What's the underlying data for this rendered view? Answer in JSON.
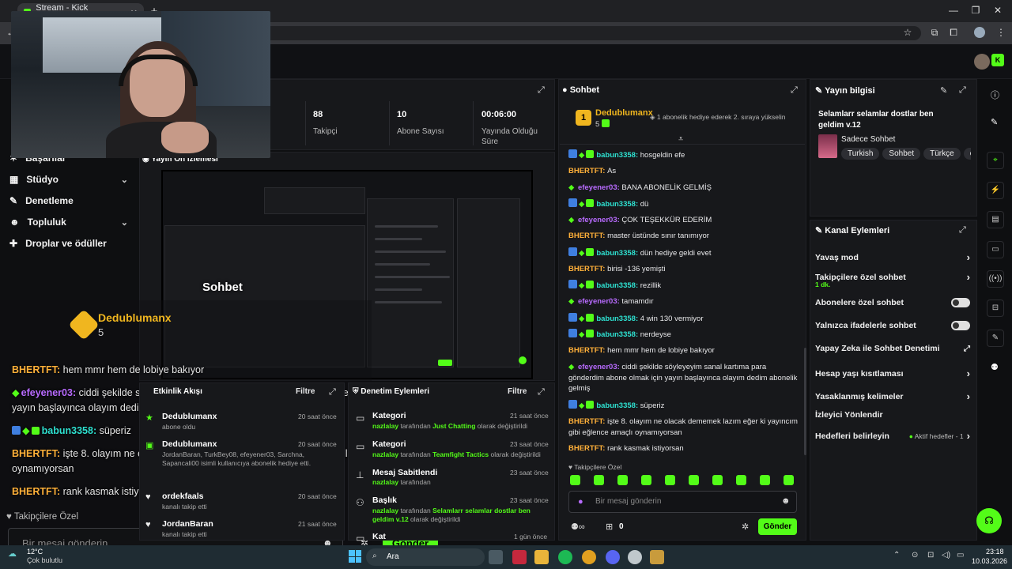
{
  "browser": {
    "tab_title": "Stream - Kick Dashboard",
    "tab_close": "✕",
    "new_tab": "+"
  },
  "stats": [
    {
      "value": "88",
      "label": "Takipçi"
    },
    {
      "value": "10",
      "label": "Abone Sayısı"
    },
    {
      "value": "00:06:00",
      "label": "Yayında Olduğu Süre"
    }
  ],
  "sidebar": {
    "items": [
      {
        "label": "Başarılar",
        "chev": ""
      },
      {
        "label": "Stüdyo",
        "chev": "⌄"
      },
      {
        "label": "Denetleme",
        "chev": ""
      },
      {
        "label": "Topluluk",
        "chev": "⌄"
      },
      {
        "label": "Droplar ve ödüller",
        "chev": ""
      }
    ]
  },
  "preview": {
    "title": "Yayın Ön İzlemesi"
  },
  "chat": {
    "title": "Sohbet",
    "pinned_user": "Dedublumanx",
    "pinned_count": "5",
    "pinned_badge": "1",
    "pinned_msg": "1 abonelik hediye ederek 2. sıraya yükselin",
    "messages": [
      {
        "user": "babun3358",
        "text": "hosgeldin efe",
        "type": "cyan",
        "badges": "vip"
      },
      {
        "user": "BHERTFT",
        "text": "As",
        "type": "orange",
        "badges": ""
      },
      {
        "user": "efeyener03",
        "text": "BANA ABONELİK GELMİŞ",
        "type": "pink",
        "badges": "star"
      },
      {
        "user": "babun3358",
        "text": "dü",
        "type": "cyan",
        "badges": "vip"
      },
      {
        "user": "efeyener03",
        "text": "ÇOK TEŞEKKÜR EDERİM",
        "type": "pink",
        "badges": "star"
      },
      {
        "user": "BHERTFT",
        "text": "master üstünde sınır tanımıyor",
        "type": "orange",
        "badges": ""
      },
      {
        "user": "babun3358",
        "text": "dün hediye geldi evet",
        "type": "cyan",
        "badges": "vip"
      },
      {
        "user": "BHERTFT",
        "text": "birisi -136 yemişti",
        "type": "orange",
        "badges": ""
      },
      {
        "user": "babun3358",
        "text": "rezillik",
        "type": "cyan",
        "badges": "vip"
      },
      {
        "user": "efeyener03",
        "text": "tamamdır",
        "type": "pink",
        "badges": "star"
      },
      {
        "user": "babun3358",
        "text": "4 win 130 vermiyor",
        "type": "cyan",
        "badges": "vip"
      },
      {
        "user": "babun3358",
        "text": "nerdeyse",
        "type": "cyan",
        "badges": "vip"
      },
      {
        "user": "BHERTFT",
        "text": "hem mmr hem de lobiye bakıyor",
        "type": "orange",
        "badges": ""
      },
      {
        "user": "efeyener03",
        "text": "ciddi şekilde söyleyeyim sanal kartıma para gönderdim abone olmak için yayın başlayınca olayım dedim abonelik gelmiş",
        "type": "pink",
        "badges": "star"
      },
      {
        "user": "babun3358",
        "text": "süperiz",
        "type": "cyan",
        "badges": "vip"
      },
      {
        "user": "BHERTFT",
        "text": "işte 8. olayım ne olacak dememek lazım eğer ki yayıncım gibi eğlence amaçlı oynamıyorsan",
        "type": "orange",
        "badges": ""
      },
      {
        "user": "BHERTFT",
        "text": "rank kasmak istiyorsan",
        "type": "orange",
        "badges": ""
      }
    ],
    "followers_only": "Takipçilere Özel",
    "placeholder": "Bir mesaj gönderin",
    "points": "0",
    "send": "Gönder"
  },
  "stream_info": {
    "title": "Yayın bilgisi",
    "stream_title": "Selamlarr selamlar dostlar ben geldim v.12",
    "category": "Sadece Sohbet",
    "tags": [
      "Turkish",
      "Sohbet",
      "Türkçe",
      "chi"
    ]
  },
  "channel_actions": {
    "title": "Kanal Eylemleri",
    "rows": [
      {
        "label": "Yavaş mod",
        "control": "chev",
        "sub": ""
      },
      {
        "label": "Takipçilere özel sohbet",
        "control": "chev",
        "sub": "1 dk."
      },
      {
        "label": "Abonelere özel sohbet",
        "control": "toggle",
        "sub": ""
      },
      {
        "label": "Yalnızca ifadelerle sohbet",
        "control": "toggle",
        "sub": ""
      },
      {
        "label": "Yapay Zeka ile Sohbet Denetimi",
        "control": "ext",
        "sub": ""
      },
      {
        "label": "Hesap yaşı kısıtlaması",
        "control": "chev",
        "sub": ""
      },
      {
        "label": "Yasaklanmış kelimeler",
        "control": "chev",
        "sub": ""
      },
      {
        "label": "İzleyici Yönlendir",
        "control": "",
        "sub": ""
      },
      {
        "label": "Hedefleri belirleyin",
        "control": "chev",
        "sub": "Aktif hedefler - 1"
      }
    ]
  },
  "activity": {
    "title": "Etkinlik Akışı",
    "filter": "Filtre",
    "items": [
      {
        "name": "Dedublumanx",
        "time": "20 saat önce",
        "desc": "abone oldu"
      },
      {
        "name": "Dedublumanx",
        "time": "20 saat önce",
        "desc": "JordanBaran, TurkBey08, efeyener03, Sarchna, Sapancali00 isimli kullanıcıya abonelik hediye etti."
      },
      {
        "name": "ordekfaals",
        "time": "20 saat önce",
        "desc": "kanalı takip etti"
      },
      {
        "name": "JordanBaran",
        "time": "21 saat önce",
        "desc": "kanalı takip etti"
      }
    ]
  },
  "mod_actions": {
    "title": "Denetim Eylemleri",
    "filter": "Filtre",
    "items": [
      {
        "title": "Kategori",
        "time": "21 saat önce",
        "actor": "nazlalay",
        "mid": " tarafından ",
        "target": "Just Chatting",
        "end": " olarak değiştirildi"
      },
      {
        "title": "Kategori",
        "time": "23 saat önce",
        "actor": "nazlalay",
        "mid": " tarafından ",
        "target": "Teamfight Tactics",
        "end": " olarak değiştirildi"
      },
      {
        "title": "Mesaj Sabitlendi",
        "time": "23 saat önce",
        "actor": "nazlalay",
        "mid": " tarafından",
        "target": "",
        "end": ""
      },
      {
        "title": "Başlık",
        "time": "23 saat önce",
        "actor": "nazlalay",
        "mid": " tarafından ",
        "target": "Selamlarr selamlar dostlar ben geldim v.12",
        "end": " olarak değiştirildi"
      }
    ],
    "partial": "Kat",
    "partial_time": "1 gün önce"
  },
  "overlay": {
    "pinned_user": "Dedublumanx",
    "pinned_count": "5",
    "chat_title": "Sohbet",
    "lines": [
      {
        "user": "BHERTFT",
        "text": "hem mmr hem de lobiye bakıyor",
        "type": "orange"
      },
      {
        "user": "efeyener03",
        "text": "ciddi şekilde söyleyeyim sanal kartıma para gönderdim abone olmak için yayın başlayınca olayım dedim abonelik gelmiş",
        "type": "pink"
      },
      {
        "user": "babun3358",
        "text": "süperiz",
        "type": "cyan"
      },
      {
        "user": "BHERTFT",
        "text": "işte 8. olayım ne olacak dememek lazım eğer ki yayıncım gibi eğlence amaçlı oynamıyorsan",
        "type": "orange"
      },
      {
        "user": "BHERTFT",
        "text": "rank kasmak istiyorsan",
        "type": "orange"
      }
    ],
    "followers_only": "Takipçilere Özel",
    "placeholder": "Bir mesaj gönderin",
    "send": "Gönder"
  },
  "taskbar": {
    "weather_temp": "12°C",
    "weather_desc": "Çok bulutlu",
    "search": "Ara",
    "time": "23:18",
    "date": "10.03.2026"
  },
  "colors": {
    "accent": "#53fc18",
    "panel": "#17181b",
    "bg": "#0e0f11"
  }
}
